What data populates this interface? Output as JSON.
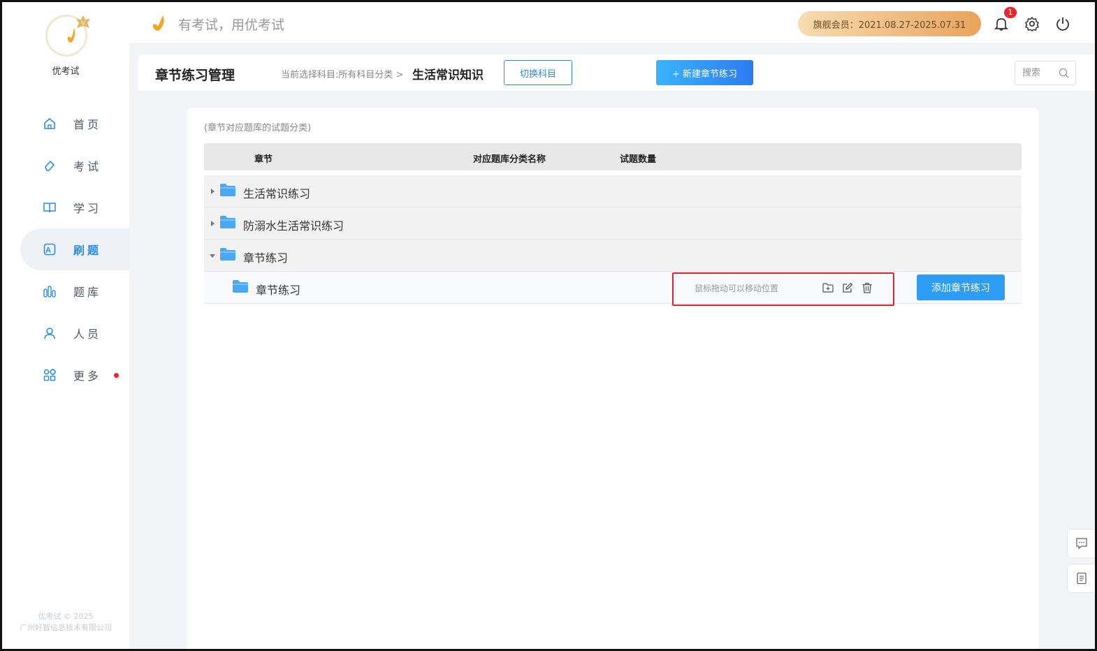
{
  "brand": {
    "name": "优考试",
    "slogan": "有考试，用优考试",
    "copyright_line1": "优考试 © 2025",
    "copyright_line2": "广州好智信息技术有限公司"
  },
  "sidebar": {
    "items": [
      {
        "label": "首页",
        "icon": "home-icon",
        "active": false
      },
      {
        "label": "考试",
        "icon": "eraser-icon",
        "active": false
      },
      {
        "label": "学习",
        "icon": "book-icon",
        "active": false
      },
      {
        "label": "刷题",
        "icon": "letter-a-icon",
        "active": true
      },
      {
        "label": "题库",
        "icon": "bar-chart-icon",
        "active": false
      },
      {
        "label": "人员",
        "icon": "user-icon",
        "active": false
      },
      {
        "label": "更多",
        "icon": "apps-icon",
        "active": false,
        "has_dot": true
      }
    ]
  },
  "header": {
    "member_text": "旗舰会员：2021.08.27-2025.07.31",
    "notification_count": "1"
  },
  "titlebar": {
    "title": "章节练习管理",
    "breadcrumb_prefix": "当前选择科目:所有科目分类 >",
    "breadcrumb_current": "生活常识知识",
    "switch_button": "切换科目",
    "new_button": "+ 新建章节练习",
    "search_placeholder": "搜索"
  },
  "table": {
    "hint": "(章节对应题库的试题分类)",
    "columns": [
      "章节",
      "对应题库分类名称",
      "试题数量"
    ],
    "rows": [
      {
        "label": "生活常识练习",
        "expanded": false,
        "level": 0
      },
      {
        "label": "防溺水生活常识练习",
        "expanded": false,
        "level": 0
      },
      {
        "label": "章节练习",
        "expanded": true,
        "level": 0
      },
      {
        "label": "章节练习",
        "expanded": false,
        "level": 1
      }
    ],
    "drag_hint": "鼠标拖动可以移动位置",
    "add_button": "添加章节练习"
  },
  "colors": {
    "accent": "#2a8cf0",
    "folder": "#4aa8f5",
    "highlight": "#e0262b",
    "member_gold": "#e8a35c"
  }
}
